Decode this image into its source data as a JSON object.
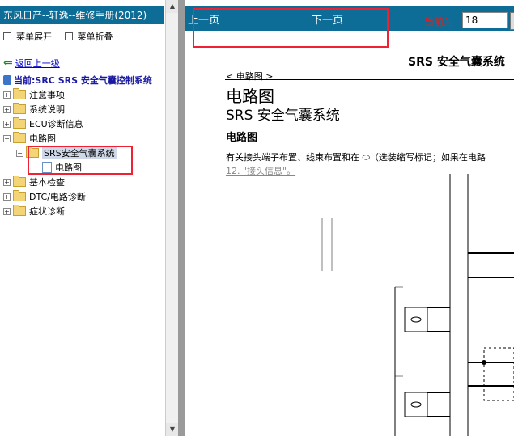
{
  "left": {
    "title": "东风日产--轩逸--维修手册(2012)",
    "expand_label": "菜单展开",
    "collapse_label": "菜单折叠",
    "back_label": "返回上一级",
    "current_label": "当前:SRC SRS 安全气囊控制系统",
    "tree": [
      {
        "label": "注意事项",
        "expanded": false
      },
      {
        "label": "系统说明",
        "expanded": false
      },
      {
        "label": "ECU诊断信息",
        "expanded": false
      },
      {
        "label": "电路图",
        "expanded": true
      },
      {
        "label": "SRS安全气囊系统",
        "expanded": true,
        "selected": true
      },
      {
        "label": "电路图",
        "type": "page"
      },
      {
        "label": "基本检查",
        "expanded": false
      },
      {
        "label": "DTC/电路诊断",
        "expanded": false
      },
      {
        "label": "症状诊断",
        "expanded": false
      }
    ]
  },
  "right": {
    "prev_label": "上一页",
    "next_label": "下一页",
    "current_label": "当前为",
    "page_value": "18",
    "doc_title": "SRS 安全气囊系统",
    "tag": "< 电路图 >",
    "heading1": "电路图",
    "heading2": "SRS 安全气囊系统",
    "heading3": "电路图",
    "paragraph": "有关接头端子布置、线束布置和在 ⬭（选装缩写标记；如果在电路",
    "link": "12. \"接头信息\"。"
  },
  "colors": {
    "header_bg": "#0e6d96",
    "highlight_box": "#e02233",
    "current_label": "#e02020"
  }
}
